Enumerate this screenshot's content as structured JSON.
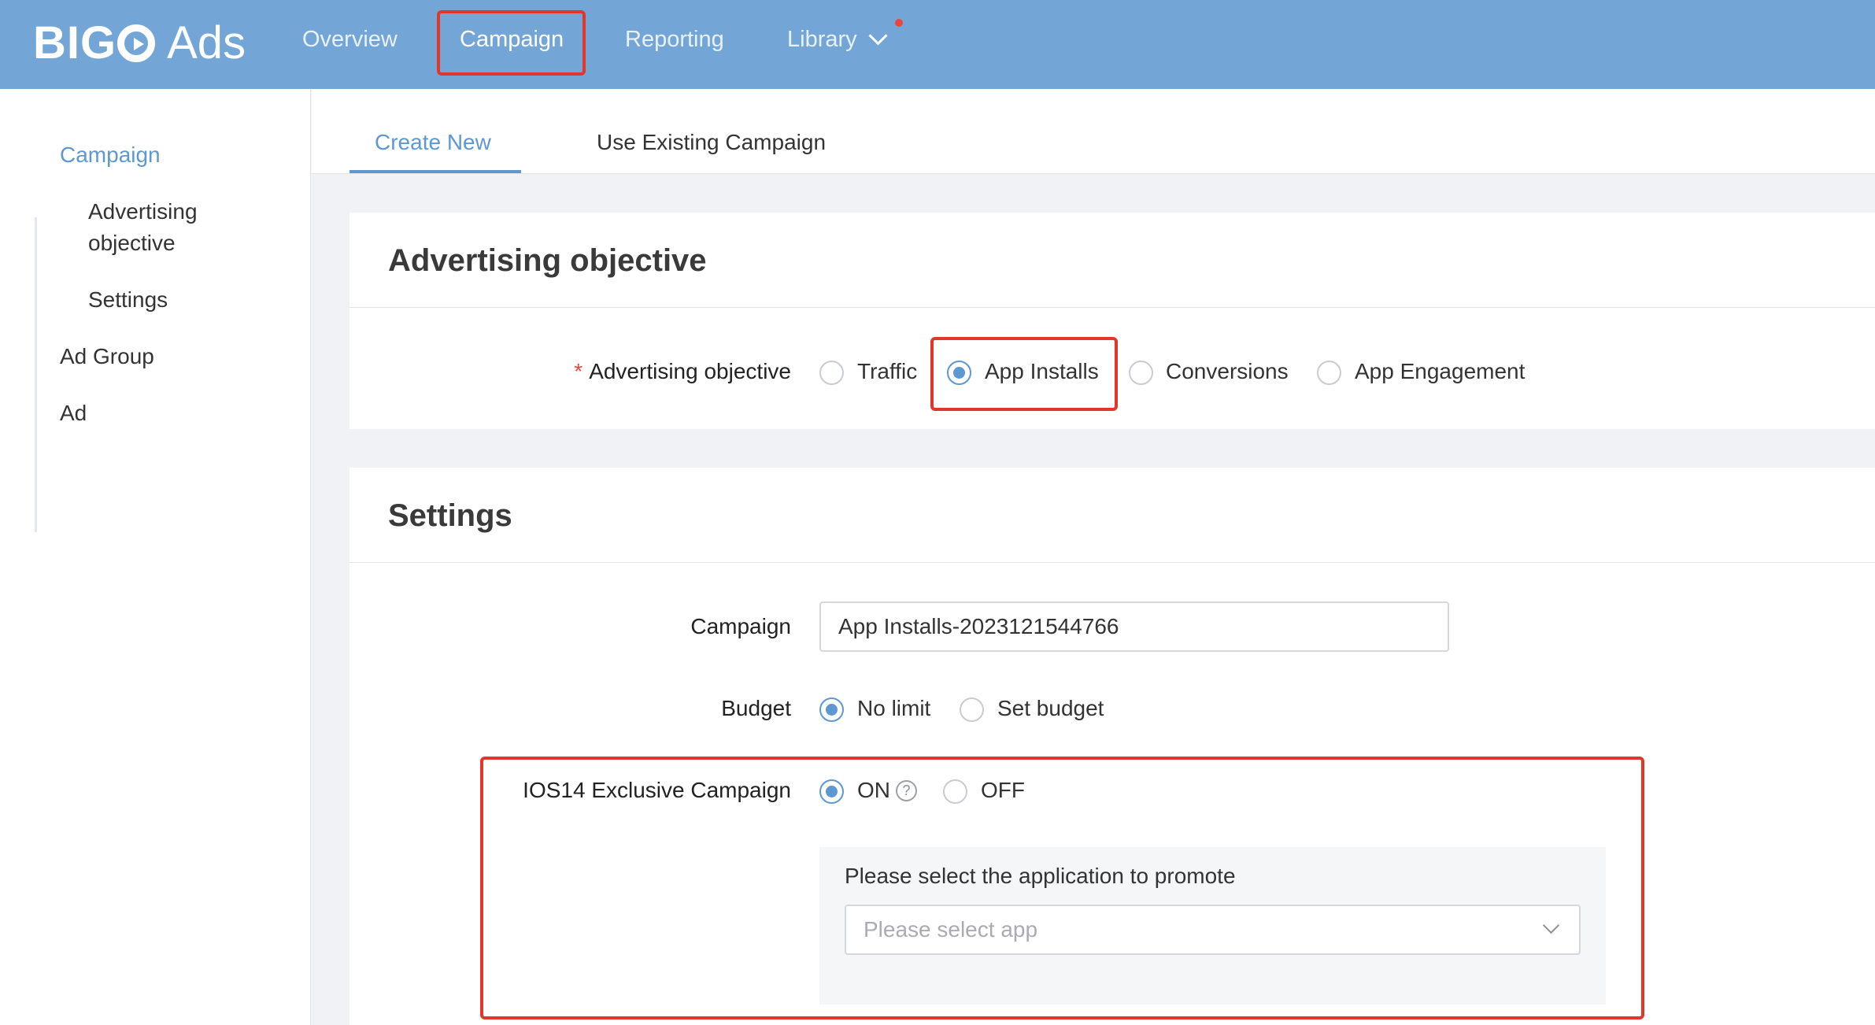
{
  "header": {
    "logo_brand": "BIG",
    "logo_product": "Ads",
    "nav": {
      "overview": "Overview",
      "campaign": "Campaign",
      "reporting": "Reporting",
      "library": "Library"
    },
    "active_nav": "Campaign"
  },
  "sidebar": {
    "items": [
      {
        "label": "Campaign",
        "active": true
      },
      {
        "label": "Advertising"
      },
      {
        "label": "objective"
      },
      {
        "label": "Settings"
      },
      {
        "label": "Ad Group"
      },
      {
        "label": "Ad"
      }
    ]
  },
  "tabs": {
    "create_new": "Create New",
    "use_existing": "Use Existing Campaign",
    "active": "Create New"
  },
  "objective_section": {
    "title": "Advertising objective",
    "field_label": "Advertising objective",
    "required_mark": "*",
    "options": [
      "Traffic",
      "App Installs",
      "Conversions",
      "App Engagement"
    ],
    "selected": "App Installs"
  },
  "settings_section": {
    "title": "Settings",
    "campaign_label": "Campaign",
    "campaign_value": "App Installs-2023121544766",
    "budget_label": "Budget",
    "budget_options": [
      "No limit",
      "Set budget"
    ],
    "budget_selected": "No limit",
    "ios14_label": "IOS14 Exclusive Campaign",
    "ios14_options": [
      "ON",
      "OFF"
    ],
    "ios14_selected": "ON",
    "help_glyph": "?",
    "app_prompt": "Please select the application to promote",
    "app_placeholder": "Please select app"
  },
  "colors": {
    "topbar": "#73a6d6",
    "accent": "#5d98d2",
    "highlight": "#e2362b"
  }
}
